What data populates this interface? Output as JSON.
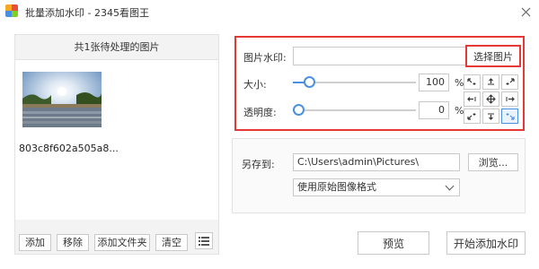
{
  "window": {
    "title": "批量添加水印 - 2345看图王",
    "close_icon": "close-icon",
    "app_icon": "app-logo-icon"
  },
  "left_panel": {
    "header": "共1张待处理的图片",
    "images": [
      {
        "name": "803c8f602a505a8..."
      }
    ],
    "buttons": {
      "add": "添加",
      "remove": "移除",
      "add_folder": "添加文件夹",
      "clear": "清空"
    },
    "list_icon": "list-icon"
  },
  "watermark": {
    "image_label": "图片水印:",
    "image_value": "",
    "choose_button": "选择图片",
    "size_label": "大小:",
    "size_value": "100",
    "size_unit": "%",
    "size_slider_fraction": 0.1,
    "opacity_label": "透明度:",
    "opacity_value": "0",
    "opacity_unit": "%",
    "opacity_slider_fraction": 0.0,
    "position_grid": {
      "selected": "bottom-right",
      "cells": [
        "top-left",
        "top-center",
        "top-right",
        "middle-left",
        "center",
        "middle-right",
        "bottom-left",
        "bottom-center",
        "bottom-right"
      ]
    }
  },
  "save": {
    "save_to_label": "另存到:",
    "path": "C:\\Users\\admin\\Pictures\\",
    "browse_button": "浏览...",
    "format_selected": "使用原始图像格式"
  },
  "footer": {
    "preview_button": "预览",
    "start_button": "开始添加水印"
  },
  "colors": {
    "highlight_border": "#e53935",
    "accent": "#4a90e2"
  }
}
